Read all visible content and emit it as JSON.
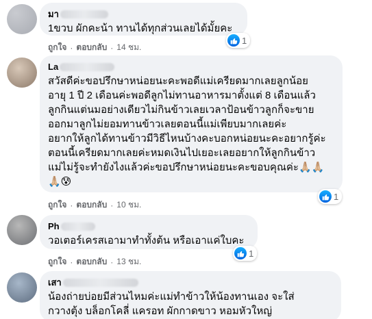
{
  "actions": {
    "like": "ถูกใจ",
    "reply": "ตอบกลับ",
    "sep": "·"
  },
  "comments": [
    {
      "author": "มา",
      "text_lines": [
        "1ขวบ ผักคะน้า ทานได้ทุกส่วนเลยได้มั้ยคะ"
      ],
      "time": "14 ชม.",
      "reactions": "1"
    },
    {
      "author": "La",
      "text_lines": [
        "สวัสดีค่ะขอปรึกษาหน่อยนะคะพอดีแม่เครียดมากเลยลูกน้อย",
        "อายุ 1 ปี 2 เดือนค่ะพอดีลูกไม่ทานอาหารมาตั้งแต่ 8 เดือนแล้ว",
        "ลูกกินแต่นมอย่างเดียวไม่กินข้าวเลยเวลาป้อนข้าวลูกก็จะขาย",
        "ออกมาลูกไม่ยอมทานข้าวเลยตอนนี้แม่เพียบมากเลยค่ะ",
        "อยากให้ลูกได้ทานข้าวมีวิธีไหนบ้างคะบอกหน่อยนะคะอยากรู้ค่ะ",
        "ตอนนี้เครียดมากเลยค่ะหมดเงินไปเยอะเลยอยากให้ลูกกินข้าว",
        "แม่ไม่รู้จะทำยังไงแล้วค่ะขอปรึกษาหน่อยนะคะขอบคุณค่ะ🙏🏼🙏🏼",
        "🙏🏼😰"
      ],
      "time": "10 ชม.",
      "reactions": "1"
    },
    {
      "author": "Ph",
      "text_lines": [
        "วอเตอร์เครสเอามาทำทั้งต้น หรือเอาแค่ใบคะ"
      ],
      "time": "13 ชม.",
      "reactions": "1"
    },
    {
      "author": "เสา",
      "text_lines": [
        "น้องถ่ายบ่อยมีส่วนไหมค่ะแม่ทำข้าวให้น้องทานเอง จะใส่",
        "กวางตุ้ง บล็อกโคลี่ แครอท ผักกาดขาว หอมหัวใหญ่"
      ]
    }
  ]
}
